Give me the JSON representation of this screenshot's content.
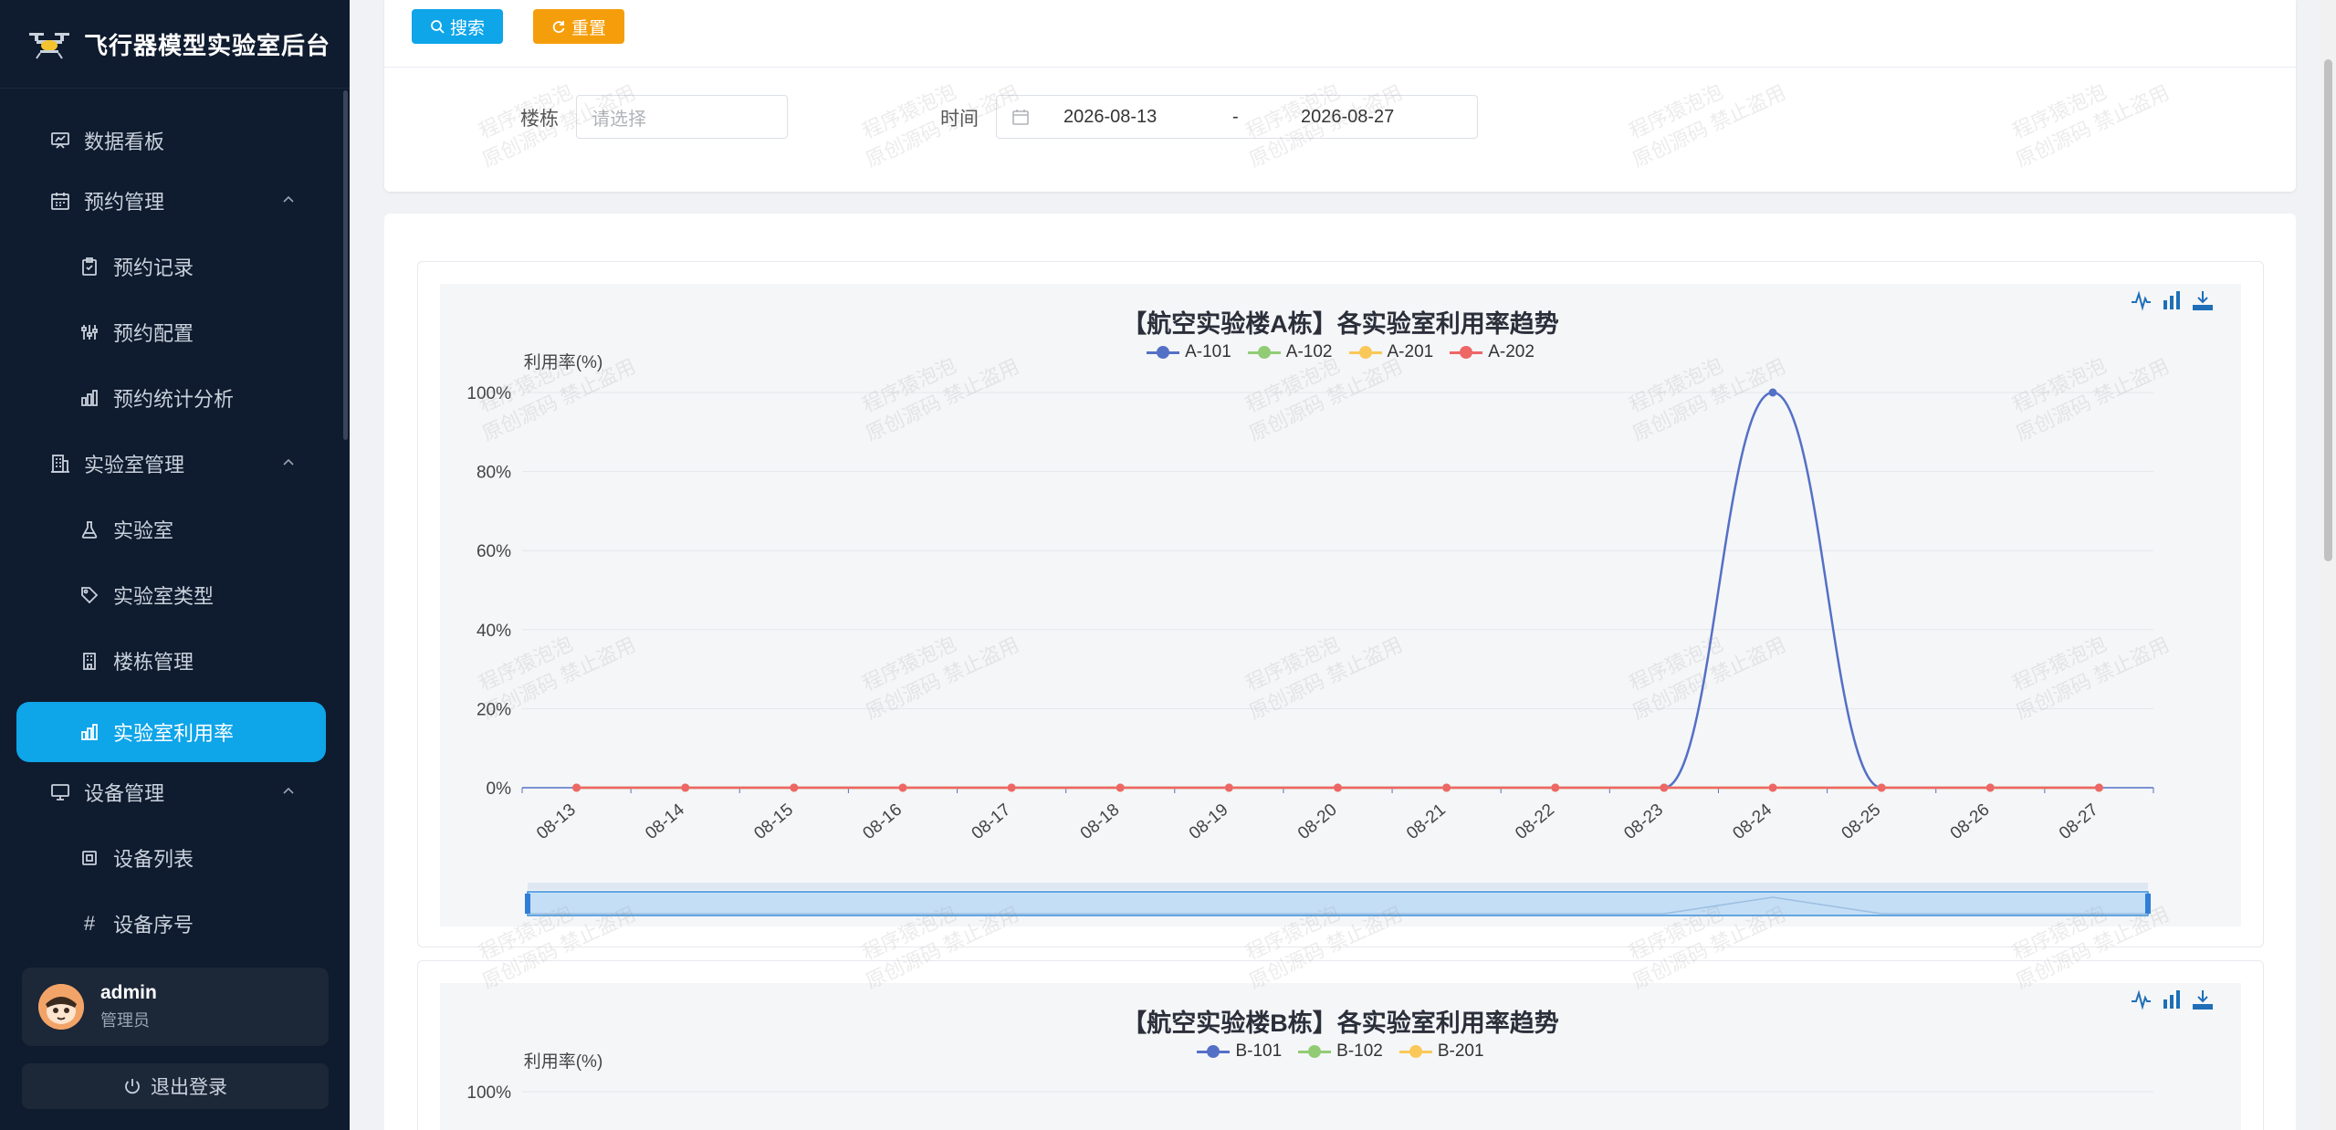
{
  "app": {
    "title": "飞行器模型实验室后台"
  },
  "sidebar": {
    "items": [
      {
        "label": "数据看板",
        "icon": "dashboard-icon",
        "level": 1
      },
      {
        "label": "预约管理",
        "icon": "calendar-icon",
        "level": 1,
        "expanded": true
      },
      {
        "label": "预约记录",
        "icon": "clipboard-icon",
        "level": 2
      },
      {
        "label": "预约配置",
        "icon": "sliders-icon",
        "level": 2
      },
      {
        "label": "预约统计分析",
        "icon": "bar-chart-icon",
        "level": 2
      },
      {
        "label": "实验室管理",
        "icon": "building-icon",
        "level": 1,
        "expanded": true
      },
      {
        "label": "实验室",
        "icon": "flask-icon",
        "level": 2
      },
      {
        "label": "实验室类型",
        "icon": "tag-icon",
        "level": 2
      },
      {
        "label": "楼栋管理",
        "icon": "building-small-icon",
        "level": 2
      },
      {
        "label": "实验室利用率",
        "icon": "bar-chart-icon",
        "level": 2,
        "active": true
      },
      {
        "label": "设备管理",
        "icon": "monitor-icon",
        "level": 1,
        "expanded": true
      },
      {
        "label": "设备列表",
        "icon": "chip-icon",
        "level": 2
      },
      {
        "label": "设备序号",
        "icon": "hash-icon",
        "level": 2
      }
    ]
  },
  "user": {
    "name": "admin",
    "role": "管理员"
  },
  "logout_label": "退出登录",
  "toolbar": {
    "search_label": "搜索",
    "reset_label": "重置"
  },
  "filters": {
    "building_label": "楼栋",
    "building_placeholder": "请选择",
    "time_label": "时间",
    "date_start": "2026-08-13",
    "date_sep": "-",
    "date_end": "2026-08-27"
  },
  "watermark": {
    "line1": "程序猿泡泡",
    "line2": "原创源码 禁止盗用"
  },
  "colors": {
    "sidebar_bg": "#0f1b2e",
    "accent": "#0ea5e9",
    "reset": "#f59e0b",
    "series": [
      "#5470c6",
      "#91cc75",
      "#fac858",
      "#ee6666"
    ]
  },
  "chart_data": [
    {
      "type": "line",
      "title": "【航空实验楼A栋】各实验室利用率趋势",
      "ylabel": "利用率(%)",
      "ylim": [
        0,
        100
      ],
      "y_ticks": [
        "0%",
        "20%",
        "40%",
        "60%",
        "80%",
        "100%"
      ],
      "categories": [
        "08-13",
        "08-14",
        "08-15",
        "08-16",
        "08-17",
        "08-18",
        "08-19",
        "08-20",
        "08-21",
        "08-22",
        "08-23",
        "08-24",
        "08-25",
        "08-26",
        "08-27"
      ],
      "series": [
        {
          "name": "A-101",
          "values": [
            0,
            0,
            0,
            0,
            0,
            0,
            0,
            0,
            0,
            0,
            0,
            100,
            0,
            0,
            0
          ]
        },
        {
          "name": "A-102",
          "values": [
            0,
            0,
            0,
            0,
            0,
            0,
            0,
            0,
            0,
            0,
            0,
            0,
            0,
            0,
            0
          ]
        },
        {
          "name": "A-201",
          "values": [
            0,
            0,
            0,
            0,
            0,
            0,
            0,
            0,
            0,
            0,
            0,
            0,
            0,
            0,
            0
          ]
        },
        {
          "name": "A-202",
          "values": [
            0,
            0,
            0,
            0,
            0,
            0,
            0,
            0,
            0,
            0,
            0,
            0,
            0,
            0,
            0
          ]
        }
      ],
      "smooth": true,
      "grid": true,
      "legend": "top-center",
      "data_zoom": true
    },
    {
      "type": "line",
      "title": "【航空实验楼B栋】各实验室利用率趋势",
      "ylabel": "利用率(%)",
      "y_ticks": [
        "100%"
      ],
      "series": [
        {
          "name": "B-101"
        },
        {
          "name": "B-102"
        },
        {
          "name": "B-201"
        }
      ],
      "legend": "top-center"
    }
  ]
}
